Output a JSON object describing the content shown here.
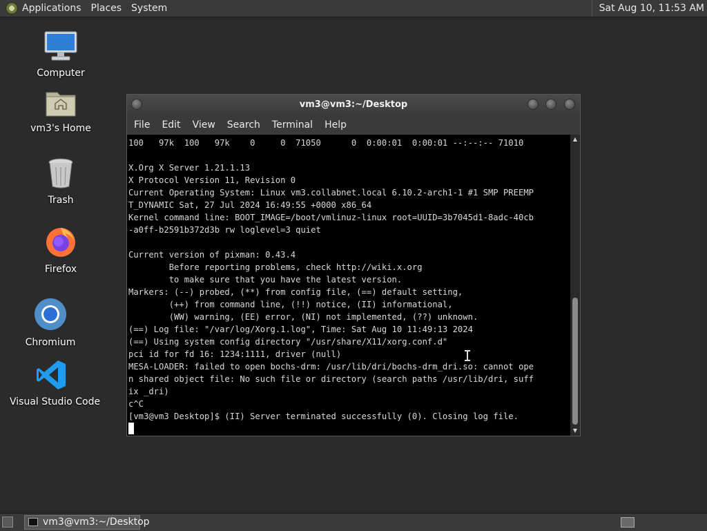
{
  "top_panel": {
    "menus": [
      "Applications",
      "Places",
      "System"
    ],
    "clock": "Sat Aug 10, 11:53 AM"
  },
  "desktop_icons": [
    {
      "label": "Computer",
      "icon": "computer-icon"
    },
    {
      "label": "vm3's Home",
      "icon": "home-folder-icon"
    },
    {
      "label": "Trash",
      "icon": "trash-icon"
    },
    {
      "label": "Firefox",
      "icon": "firefox-icon"
    },
    {
      "label": "Chromium",
      "icon": "chromium-icon"
    },
    {
      "label": "Visual Studio Code",
      "icon": "vscode-icon"
    }
  ],
  "window": {
    "title": "vm3@vm3:~/Desktop",
    "menu": [
      "File",
      "Edit",
      "View",
      "Search",
      "Terminal",
      "Help"
    ]
  },
  "terminal": {
    "lines": [
      "100   97k  100   97k    0     0  71050      0  0:00:01  0:00:01 --:--:-- 71010",
      "",
      "X.Org X Server 1.21.1.13",
      "X Protocol Version 11, Revision 0",
      "Current Operating System: Linux vm3.collabnet.local 6.10.2-arch1-1 #1 SMP PREEMP",
      "T_DYNAMIC Sat, 27 Jul 2024 16:49:55 +0000 x86_64",
      "Kernel command line: BOOT_IMAGE=/boot/vmlinuz-linux root=UUID=3b7045d1-8adc-40cb",
      "-a0ff-b2591b372d3b rw loglevel=3 quiet",
      "",
      "Current version of pixman: 0.43.4",
      "        Before reporting problems, check http://wiki.x.org",
      "        to make sure that you have the latest version.",
      "Markers: (--) probed, (**) from config file, (==) default setting,",
      "        (++) from command line, (!!) notice, (II) informational,",
      "        (WW) warning, (EE) error, (NI) not implemented, (??) unknown.",
      "(==) Log file: \"/var/log/Xorg.1.log\", Time: Sat Aug 10 11:49:13 2024",
      "(==) Using system config directory \"/usr/share/X11/xorg.conf.d\"",
      "pci id for fd 16: 1234:1111, driver (null)",
      "MESA-LOADER: failed to open bochs-drm: /usr/lib/dri/bochs-drm_dri.so: cannot ope",
      "n shared object file: No such file or directory (search paths /usr/lib/dri, suff",
      "ix _dri)",
      "c^C",
      "[vm3@vm3 Desktop]$ (II) Server terminated successfully (0). Closing log file."
    ]
  },
  "taskbar": {
    "task_label": "vm3@vm3:~/Desktop"
  }
}
